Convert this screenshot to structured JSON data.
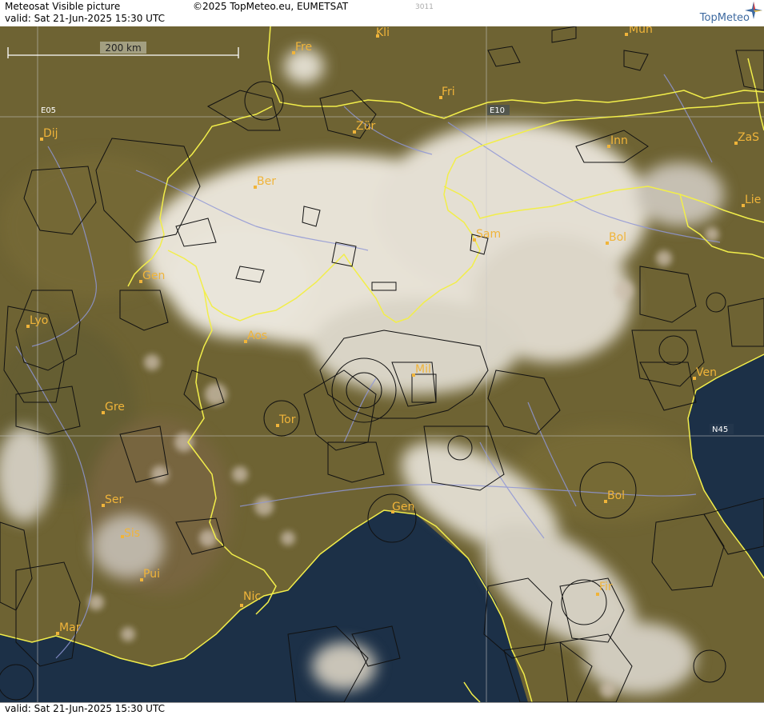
{
  "header": {
    "product_title": "Meteosat Visible picture",
    "valid_label": "valid:  Sat  21-Jun-2025  15:30 UTC",
    "copyright": "©2025 TopMeteo.eu, EUMETSAT",
    "image_code": "3011",
    "logo_text": "TopMeteo",
    "logo_icon": "compass-star-icon"
  },
  "footer": {
    "valid_label": "valid:  Sat  21-Jun-2025  15:30 UTC"
  },
  "scale_bar": {
    "label": "200 km"
  },
  "grid_labels": {
    "lon_e05": "E05",
    "lon_e10": "E10",
    "lat_n45": "N45"
  },
  "cities": {
    "kli": "Kli",
    "mun": "Mun",
    "fre": "Fre",
    "fri": "Fri",
    "dij": "Dij",
    "zur": "Zür",
    "inn": "Inn",
    "zas": "ZaS",
    "ber": "Ber",
    "lie": "Lie",
    "sam": "Sam",
    "bol_north": "Bol",
    "gen_geneva": "Gen",
    "lyo": "Lyo",
    "aos": "Aos",
    "mil": "Mil",
    "ven": "Ven",
    "gre": "Gre",
    "tor": "Tor",
    "ser": "Ser",
    "gen_genoa": "Gen",
    "bol_south": "Bol",
    "sis": "Sis",
    "pui": "Pui",
    "nic": "Nic",
    "fir": "Fir",
    "mar": "Mar"
  },
  "colors": {
    "land": "#6e6333",
    "sea": "#1c3047",
    "cloud": "#e7e2d6",
    "border": "#f2ee4a",
    "rivers": "#8f96d6",
    "airspace": "#111111",
    "city_label": "#f0b43a"
  }
}
